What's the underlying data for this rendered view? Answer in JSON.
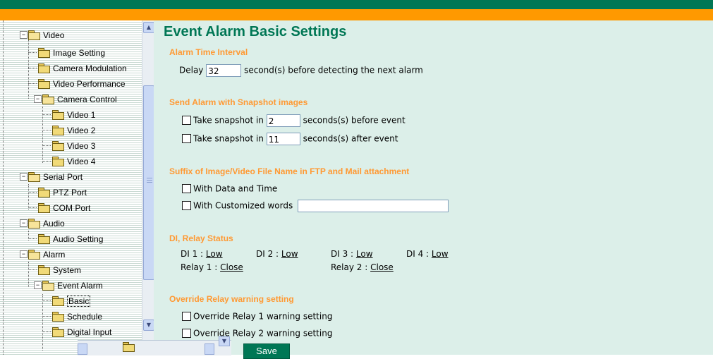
{
  "tree": {
    "items": [
      {
        "label": "Video"
      },
      {
        "label": "Image Setting"
      },
      {
        "label": "Camera Modulation"
      },
      {
        "label": "Video Performance"
      },
      {
        "label": "Camera Control"
      },
      {
        "label": "Video 1"
      },
      {
        "label": "Video 2"
      },
      {
        "label": "Video 3"
      },
      {
        "label": "Video 4"
      },
      {
        "label": "Serial Port"
      },
      {
        "label": "PTZ Port"
      },
      {
        "label": "COM Port"
      },
      {
        "label": "Audio"
      },
      {
        "label": "Audio Setting"
      },
      {
        "label": "Alarm"
      },
      {
        "label": "System"
      },
      {
        "label": "Event Alarm"
      },
      {
        "label": "Basic"
      },
      {
        "label": "Schedule"
      },
      {
        "label": "Digital Input"
      }
    ]
  },
  "content": {
    "title": "Event Alarm Basic Settings",
    "alarm_time_interval": {
      "heading": "Alarm Time Interval",
      "delay_label": "Delay",
      "delay_value": "32",
      "delay_suffix": "second(s) before detecting the next alarm"
    },
    "snapshot": {
      "heading": "Send Alarm with Snapshot images",
      "before_label": "Take snapshot in",
      "before_value": "2",
      "before_suffix": "seconds(s) before event",
      "after_label": "Take snapshot in",
      "after_value": "11",
      "after_suffix": "seconds(s) after event"
    },
    "suffix": {
      "heading": "Suffix of Image/Video File Name in FTP and Mail attachment",
      "with_date_label": "With Data and Time",
      "with_custom_label": "With Customized words",
      "custom_value": ""
    },
    "relay_status": {
      "heading": "DI, Relay Status",
      "di": [
        {
          "label": "DI 1 :",
          "value": "Low"
        },
        {
          "label": "DI 2 :",
          "value": "Low"
        },
        {
          "label": "DI 3 :",
          "value": "Low"
        },
        {
          "label": "DI 4 :",
          "value": "Low"
        }
      ],
      "relay": [
        {
          "label": "Relay 1 :",
          "value": "Close"
        },
        {
          "label": "Relay 2 :",
          "value": "Close"
        }
      ]
    },
    "override": {
      "heading": "Override Relay warning setting",
      "relay1_label": "Override Relay 1 warning setting",
      "relay2_label": "Override Relay 2 warning setting"
    }
  },
  "footer": {
    "save_label": "Save"
  },
  "colors": {
    "brand_green": "#007755",
    "accent_orange": "#ff9900",
    "content_bg": "#dcefe9"
  },
  "icons": {
    "folder": "folder-icon",
    "expand": "minus-box-icon",
    "scroll_up": "chevron-up-icon",
    "scroll_down": "chevron-down-icon"
  }
}
